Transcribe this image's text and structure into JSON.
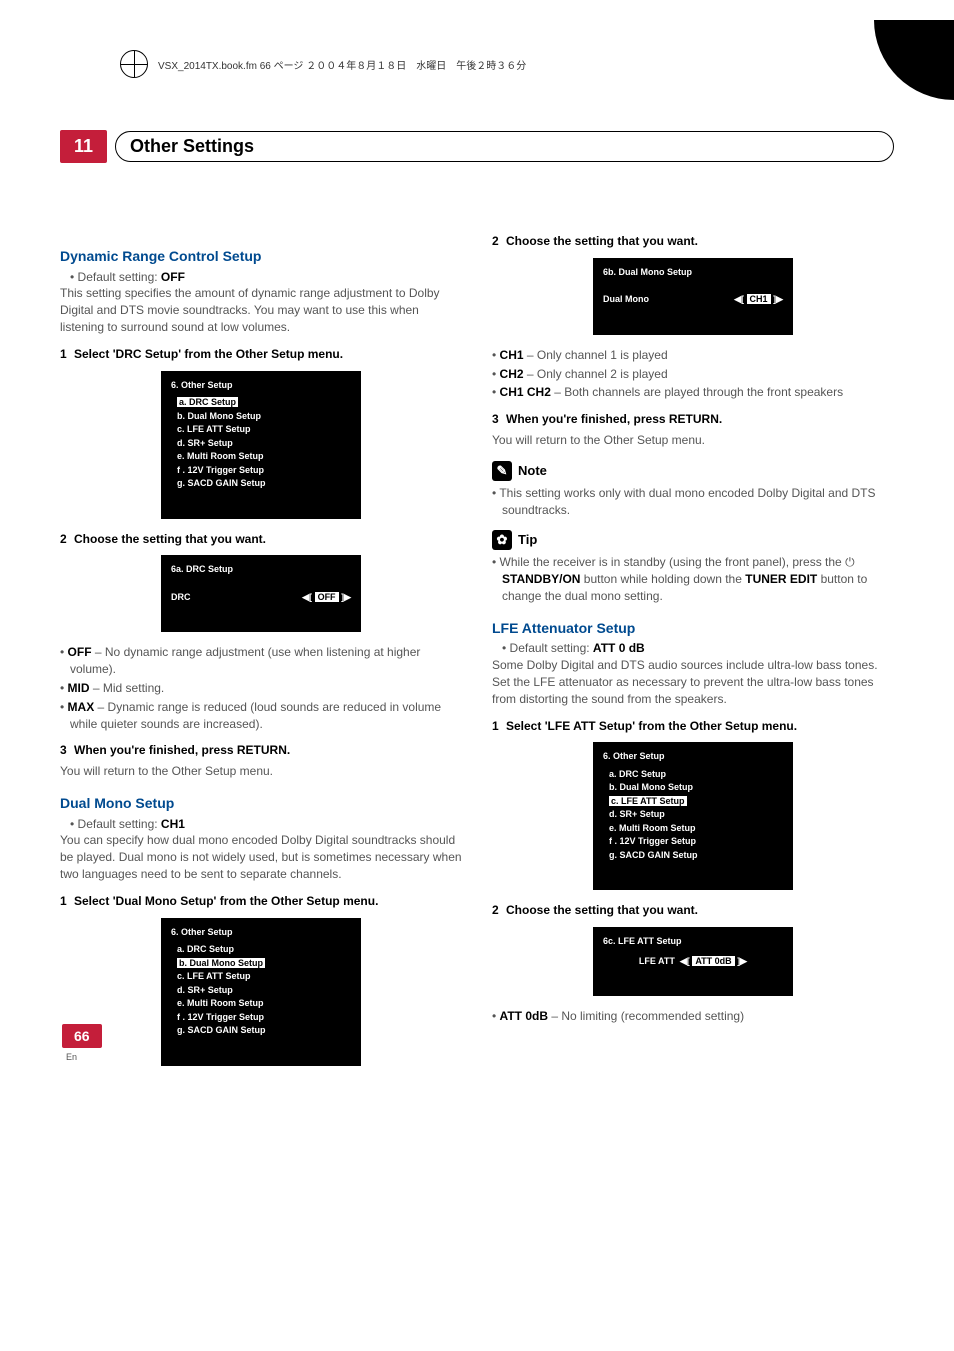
{
  "cropline": "VSX_2014TX.book.fm 66 ページ  ２００４年８月１８日　水曜日　午後２時３６分",
  "chapter": {
    "num": "11",
    "title": "Other Settings"
  },
  "col1": {
    "sec1": {
      "heading": "Dynamic Range Control Setup",
      "default": "• Default setting: ",
      "default_val": "OFF",
      "body": "This setting specifies the amount of dynamic range adjustment to Dolby Digital and DTS movie soundtracks. You may want to use this when listening to surround sound at low volumes.",
      "step1": "Select 'DRC Setup' from the Other Setup menu.",
      "osd1": {
        "title": "6. Other Setup",
        "items": [
          "a. DRC Setup",
          "b. Dual Mono Setup",
          "c. LFE ATT Setup",
          "d. SR+ Setup",
          "e. Multi Room Setup",
          "f . 12V Trigger Setup",
          "g. SACD GAIN Setup"
        ],
        "hl_index": 0
      },
      "step2": "Choose the setting that you want.",
      "osd2": {
        "title": "6a. DRC Setup",
        "label": "DRC",
        "value": "OFF"
      },
      "opts": [
        {
          "k": "OFF",
          "v": " – No dynamic range adjustment (use when listening at higher volume)."
        },
        {
          "k": "MID",
          "v": " – Mid setting."
        },
        {
          "k": "MAX",
          "v": " – Dynamic range is reduced (loud sounds are reduced in volume while quieter sounds are increased)."
        }
      ],
      "step3": "When you're finished, press RETURN.",
      "ret": "You will return to the Other Setup menu."
    },
    "sec2": {
      "heading": "Dual Mono Setup",
      "default": "• Default setting: ",
      "default_val": "CH1",
      "body": "You can specify how dual mono encoded Dolby Digital soundtracks should be played. Dual mono is not widely used, but is sometimes necessary when two languages need to be sent to separate channels.",
      "step1": "Select 'Dual Mono Setup' from the Other Setup menu.",
      "osd1": {
        "title": "6. Other Setup",
        "items": [
          "a. DRC Setup",
          "b. Dual Mono Setup",
          "c. LFE ATT Setup",
          "d. SR+ Setup",
          "e. Multi Room Setup",
          "f . 12V Trigger Setup",
          "g. SACD GAIN Setup"
        ],
        "hl_index": 1
      }
    }
  },
  "col2": {
    "step2": "Choose the setting that you want.",
    "osd2": {
      "title": "6b. Dual Mono Setup",
      "label": "Dual Mono",
      "value": "CH1"
    },
    "opts": [
      {
        "k": "CH1",
        "v": " – Only channel 1 is played"
      },
      {
        "k": "CH2",
        "v": " – Only channel 2 is played"
      },
      {
        "k": "CH1 CH2",
        "v": " – Both channels are played through the front speakers"
      }
    ],
    "step3": "When you're finished, press RETURN.",
    "ret": "You will return to the Other Setup menu.",
    "note_label": "Note",
    "note": "This setting works only with dual mono encoded Dolby Digital and DTS soundtracks.",
    "tip_label": "Tip",
    "tip_a": "While the receiver is in standby (using the front panel), press the ",
    "tip_standby": "STANDBY/ON",
    "tip_b": " button while holding down the ",
    "tip_tuner": "TUNER EDIT",
    "tip_c": " button to change the dual mono setting.",
    "sec3": {
      "heading": "LFE Attenuator Setup",
      "default": "• Default setting: ",
      "default_val": "ATT 0 dB",
      "body": "Some Dolby Digital and DTS audio sources include ultra-low bass tones. Set the LFE attenuator as necessary to prevent the ultra-low bass tones from distorting the sound from the speakers.",
      "step1": "Select 'LFE ATT Setup' from the Other Setup menu.",
      "osd1": {
        "title": "6. Other Setup",
        "items": [
          "a. DRC Setup",
          "b. Dual Mono Setup",
          "c. LFE ATT Setup",
          "d. SR+ Setup",
          "e. Multi Room Setup",
          "f . 12V Trigger Setup",
          "g. SACD GAIN Setup"
        ],
        "hl_index": 2
      },
      "step2": "Choose the setting that you want.",
      "osd2": {
        "title": "6c. LFE ATT Setup",
        "label": "LFE ATT",
        "value": "ATT 0dB"
      },
      "opt": {
        "k": "ATT 0dB",
        "v": " – No limiting (recommended setting)"
      }
    }
  },
  "page_number": "66",
  "page_lang": "En"
}
